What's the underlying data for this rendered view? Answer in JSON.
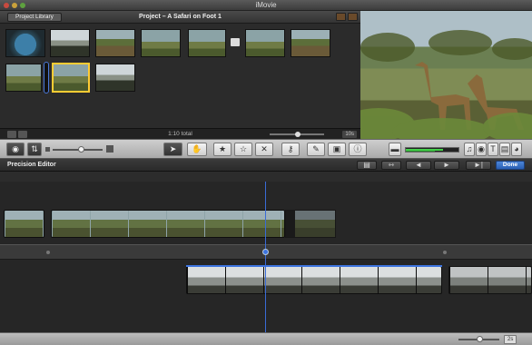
{
  "app": {
    "title": "iMovie"
  },
  "project_pane": {
    "library_button": "Project Library",
    "title": "Project – A Safari on Foot 1",
    "total": "1:10 total",
    "zoom_value": "10s"
  },
  "toolbar": {
    "tools": [
      "camera-icon",
      "swap-icon",
      "arrow-icon",
      "hand-icon",
      "star-filled-icon",
      "star-empty-icon",
      "reject-icon",
      "key-icon",
      "eyedropper-icon",
      "crop-icon",
      "info-icon",
      "music-icon",
      "photo-icon",
      "text-icon",
      "film-icon",
      "globe-icon"
    ]
  },
  "precision_editor": {
    "title": "Precision Editor",
    "done_label": "Done"
  },
  "status": {
    "zoom_value": "2s"
  },
  "colors": {
    "accent": "#3d74e0",
    "selection": "#ffcc33"
  }
}
